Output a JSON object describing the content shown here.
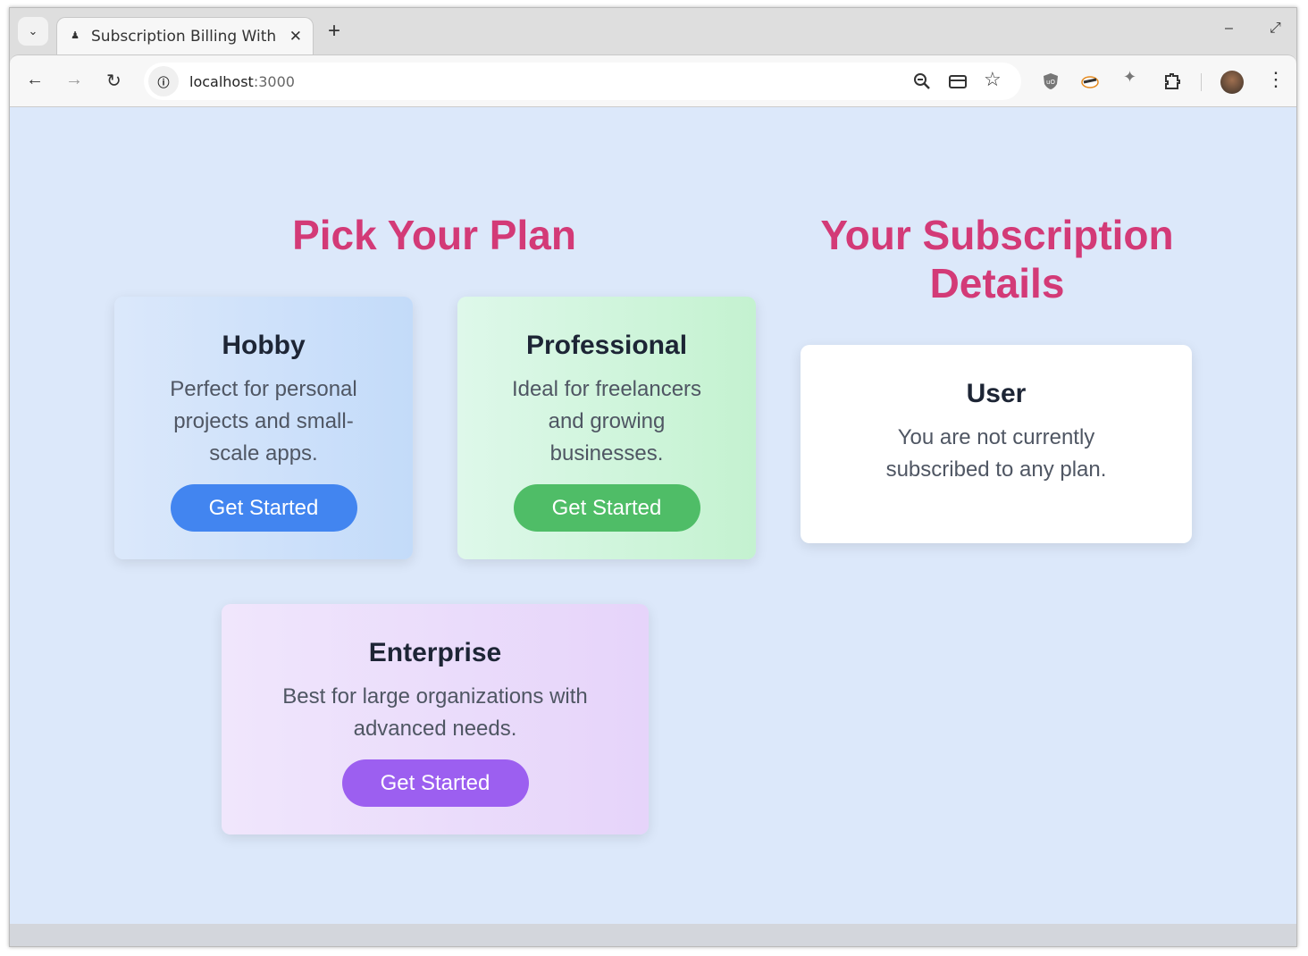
{
  "browser": {
    "tab_title": "Subscription Billing With",
    "url_host": "localhost",
    "url_port": ":3000",
    "icons": [
      "chevron-down-icon",
      "back-icon",
      "forward-icon",
      "reload-icon",
      "info-icon",
      "zoom-out-icon",
      "card-icon",
      "star-icon",
      "ublock-icon",
      "badger-icon",
      "pin-icon",
      "extensions-icon",
      "avatar",
      "menu-icon"
    ]
  },
  "plans": {
    "heading": "Pick Your Plan",
    "items": [
      {
        "name": "Hobby",
        "desc": "Perfect for personal projects and small-scale apps.",
        "button": "Get Started",
        "color": "#4285f0"
      },
      {
        "name": "Professional",
        "desc": "Ideal for freelancers and growing businesses.",
        "button": "Get Started",
        "color": "#4fbd67"
      },
      {
        "name": "Enterprise",
        "desc": "Best for large organizations with advanced needs.",
        "button": "Get Started",
        "color": "#9c5ff0"
      }
    ]
  },
  "subscription": {
    "heading": "Your Subscription Details",
    "user_title": "User",
    "status": "You are not currently subscribed to any plan."
  },
  "colors": {
    "accent": "#d33a77",
    "background": "#dce8fa"
  }
}
